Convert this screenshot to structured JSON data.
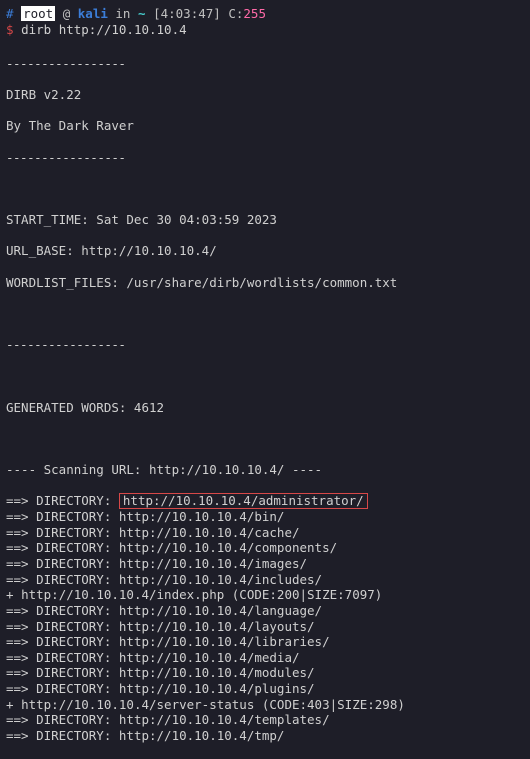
{
  "prompt": {
    "hash": "#",
    "user": "root",
    "at": "@",
    "host": "kali",
    "in_word": "in",
    "cwd": "~",
    "time": "[4:03:47]",
    "c_label": "C:",
    "c_value": "255",
    "dollar": "$",
    "command": "dirb http://10.10.10.4"
  },
  "output": {
    "hr": "-----------------",
    "version": "DIRB v2.22",
    "author": "By The Dark Raver",
    "start_time": "START_TIME: Sat Dec 30 04:03:59 2023",
    "url_base": "URL_BASE: http://10.10.10.4/",
    "wordlist": "WORDLIST_FILES: /usr/share/dirb/wordlists/common.txt",
    "gen_words": "GENERATED WORDS: 4612",
    "scanning": "---- Scanning URL: http://10.10.10.4/ ----",
    "directories": [
      {
        "prefix": "==> DIRECTORY: ",
        "url": "http://10.10.10.4/administrator/",
        "highlight": true
      },
      {
        "prefix": "==> DIRECTORY: ",
        "url": "http://10.10.10.4/bin/"
      },
      {
        "prefix": "==> DIRECTORY: ",
        "url": "http://10.10.10.4/cache/"
      },
      {
        "prefix": "==> DIRECTORY: ",
        "url": "http://10.10.10.4/components/"
      },
      {
        "prefix": "==> DIRECTORY: ",
        "url": "http://10.10.10.4/images/"
      },
      {
        "prefix": "==> DIRECTORY: ",
        "url": "http://10.10.10.4/includes/"
      },
      {
        "prefix": "+ ",
        "url": "http://10.10.10.4/index.php (CODE:200|SIZE:7097)"
      },
      {
        "prefix": "==> DIRECTORY: ",
        "url": "http://10.10.10.4/language/"
      },
      {
        "prefix": "==> DIRECTORY: ",
        "url": "http://10.10.10.4/layouts/"
      },
      {
        "prefix": "==> DIRECTORY: ",
        "url": "http://10.10.10.4/libraries/"
      },
      {
        "prefix": "==> DIRECTORY: ",
        "url": "http://10.10.10.4/media/"
      },
      {
        "prefix": "==> DIRECTORY: ",
        "url": "http://10.10.10.4/modules/"
      },
      {
        "prefix": "==> DIRECTORY: ",
        "url": "http://10.10.10.4/plugins/"
      },
      {
        "prefix": "+ ",
        "url": "http://10.10.10.4/server-status (CODE:403|SIZE:298)"
      },
      {
        "prefix": "==> DIRECTORY: ",
        "url": "http://10.10.10.4/templates/"
      },
      {
        "prefix": "==> DIRECTORY: ",
        "url": "http://10.10.10.4/tmp/"
      }
    ]
  }
}
